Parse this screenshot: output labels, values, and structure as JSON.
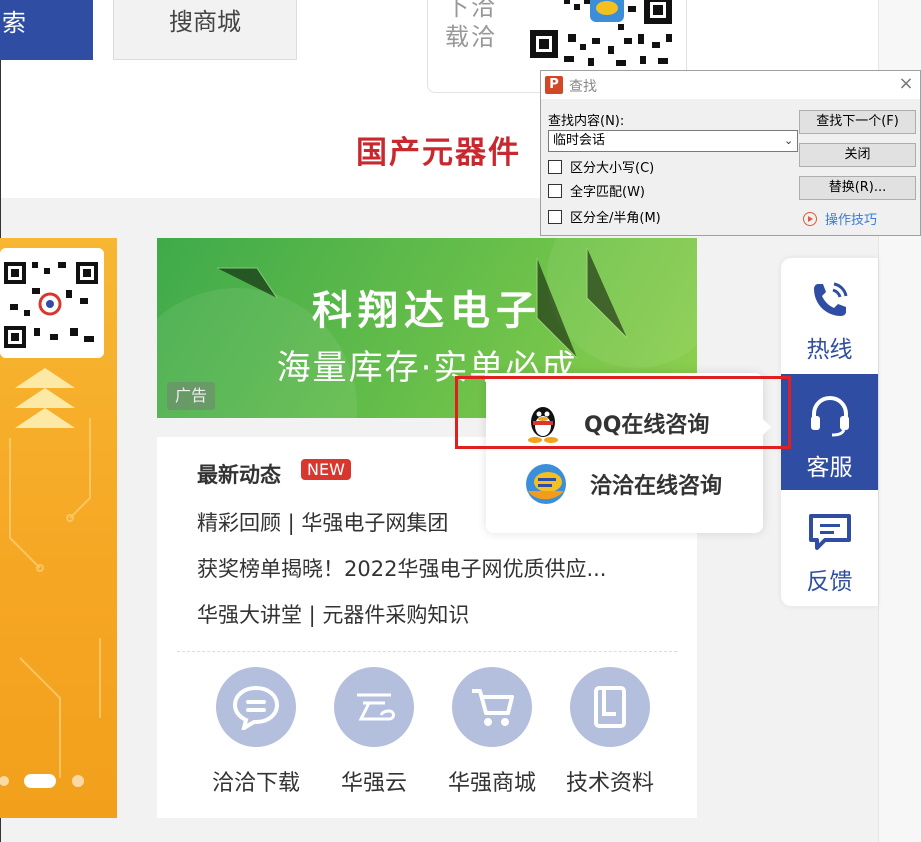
{
  "header": {
    "search_button": "索",
    "mall_search_button": "搜商城",
    "app_promo_text": "下洽\n载洽",
    "slogan": "国产元器件"
  },
  "ad_banner": {
    "title": "科翔达电子",
    "subtitle": "海量库存·实单必成",
    "tag": "广告"
  },
  "news": {
    "title": "最新动态",
    "badge": "NEW",
    "items": [
      "精彩回顾 | 华强电子网集团",
      "获奖榜单揭晓！2022华强电子网优质供应...",
      "华强大讲堂 | 元器件采购知识"
    ]
  },
  "quick_links": [
    {
      "label": "洽洽下载",
      "icon": "chat-bubble-icon"
    },
    {
      "label": "华强云",
      "icon": "cloud-icon"
    },
    {
      "label": "华强商城",
      "icon": "cart-icon"
    },
    {
      "label": "技术资料",
      "icon": "document-icon"
    }
  ],
  "side_toolbar": {
    "hotline": "热线",
    "service": "客服",
    "feedback": "反馈"
  },
  "consult_popup": {
    "qq": "QQ在线咨询",
    "qiaqia": "洽洽在线咨询"
  },
  "find_dialog": {
    "title": "查找",
    "app_icon_letter": "P",
    "close": "×",
    "label": "查找内容(N):",
    "value": "临时会话",
    "options": [
      "区分大小写(C)",
      "全字匹配(W)",
      "区分全/半角(M)"
    ],
    "buttons": [
      "查找下一个(F)",
      "关闭",
      "替换(R)..."
    ],
    "tips": "操作技巧"
  },
  "colors": {
    "brand_blue": "#2f4ea3",
    "alert_red": "#e02020",
    "ad_green": "#6cc14a",
    "banner_yellow": "#f5a623"
  }
}
